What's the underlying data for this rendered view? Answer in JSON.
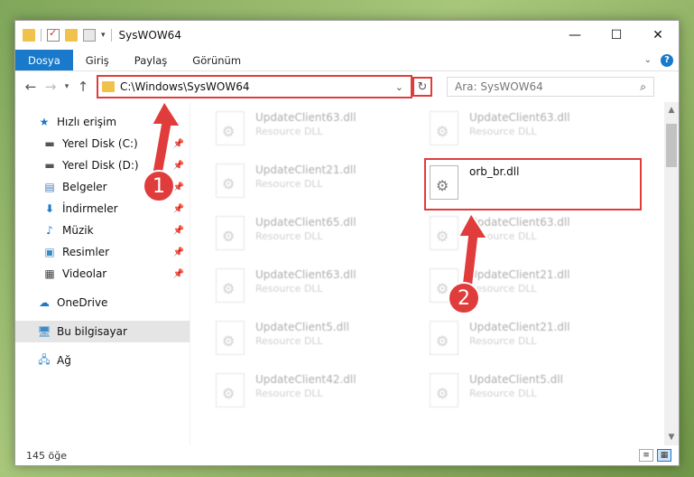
{
  "window": {
    "title": "SysWOW64",
    "controls": {
      "minimize": "—",
      "maximize": "☐",
      "close": "✕"
    }
  },
  "ribbon": {
    "tabs": [
      {
        "label": "Dosya",
        "active": true
      },
      {
        "label": "Giriş",
        "active": false
      },
      {
        "label": "Paylaş",
        "active": false
      },
      {
        "label": "Görünüm",
        "active": false
      }
    ],
    "help": "?"
  },
  "address": {
    "path": "C:\\Windows\\SysWOW64",
    "search_placeholder": "Ara: SysWOW64"
  },
  "sidebar": {
    "quick_access": "Hızlı erişim",
    "items": [
      {
        "label": "Yerel Disk (C:)",
        "icon": "drive-icon",
        "pinned": true
      },
      {
        "label": "Yerel Disk (D:)",
        "icon": "drive-icon",
        "pinned": true
      },
      {
        "label": "Belgeler",
        "icon": "documents-icon",
        "pinned": true
      },
      {
        "label": "İndirmeler",
        "icon": "download-icon",
        "pinned": true
      },
      {
        "label": "Müzik",
        "icon": "music-icon",
        "pinned": true
      },
      {
        "label": "Resimler",
        "icon": "pictures-icon",
        "pinned": true
      },
      {
        "label": "Videolar",
        "icon": "videos-icon",
        "pinned": true
      }
    ],
    "onedrive": "OneDrive",
    "this_pc": "Bu bilgisayar",
    "network": "Ağ"
  },
  "files": [
    {
      "name": "UpdateClient63.dll",
      "desc": "Resource DLL",
      "blurred": true
    },
    {
      "name": "UpdateClient63.dll",
      "desc": "Resource DLL",
      "blurred": true
    },
    {
      "name": "UpdateClient21.dll",
      "desc": "Resource DLL",
      "blurred": true
    },
    {
      "name": "orb_br.dll",
      "desc": "",
      "blurred": false
    },
    {
      "name": "UpdateClient65.dll",
      "desc": "Resource DLL",
      "blurred": true
    },
    {
      "name": "UpdateClient63.dll",
      "desc": "Resource DLL",
      "blurred": true
    },
    {
      "name": "UpdateClient63.dll",
      "desc": "Resource DLL",
      "blurred": true
    },
    {
      "name": "UpdateClient21.dll",
      "desc": "Resource DLL",
      "blurred": true
    },
    {
      "name": "UpdateClient5.dll",
      "desc": "Resource DLL",
      "blurred": true
    },
    {
      "name": "UpdateClient21.dll",
      "desc": "Resource DLL",
      "blurred": true
    },
    {
      "name": "UpdateClient42.dll",
      "desc": "Resource DLL",
      "blurred": true
    },
    {
      "name": "UpdateClient5.dll",
      "desc": "Resource DLL",
      "blurred": true
    }
  ],
  "status": {
    "count": "145 öğe"
  },
  "callouts": {
    "one": "1",
    "two": "2"
  },
  "colors": {
    "accent": "#1979ca",
    "highlight": "#e03c3c"
  }
}
